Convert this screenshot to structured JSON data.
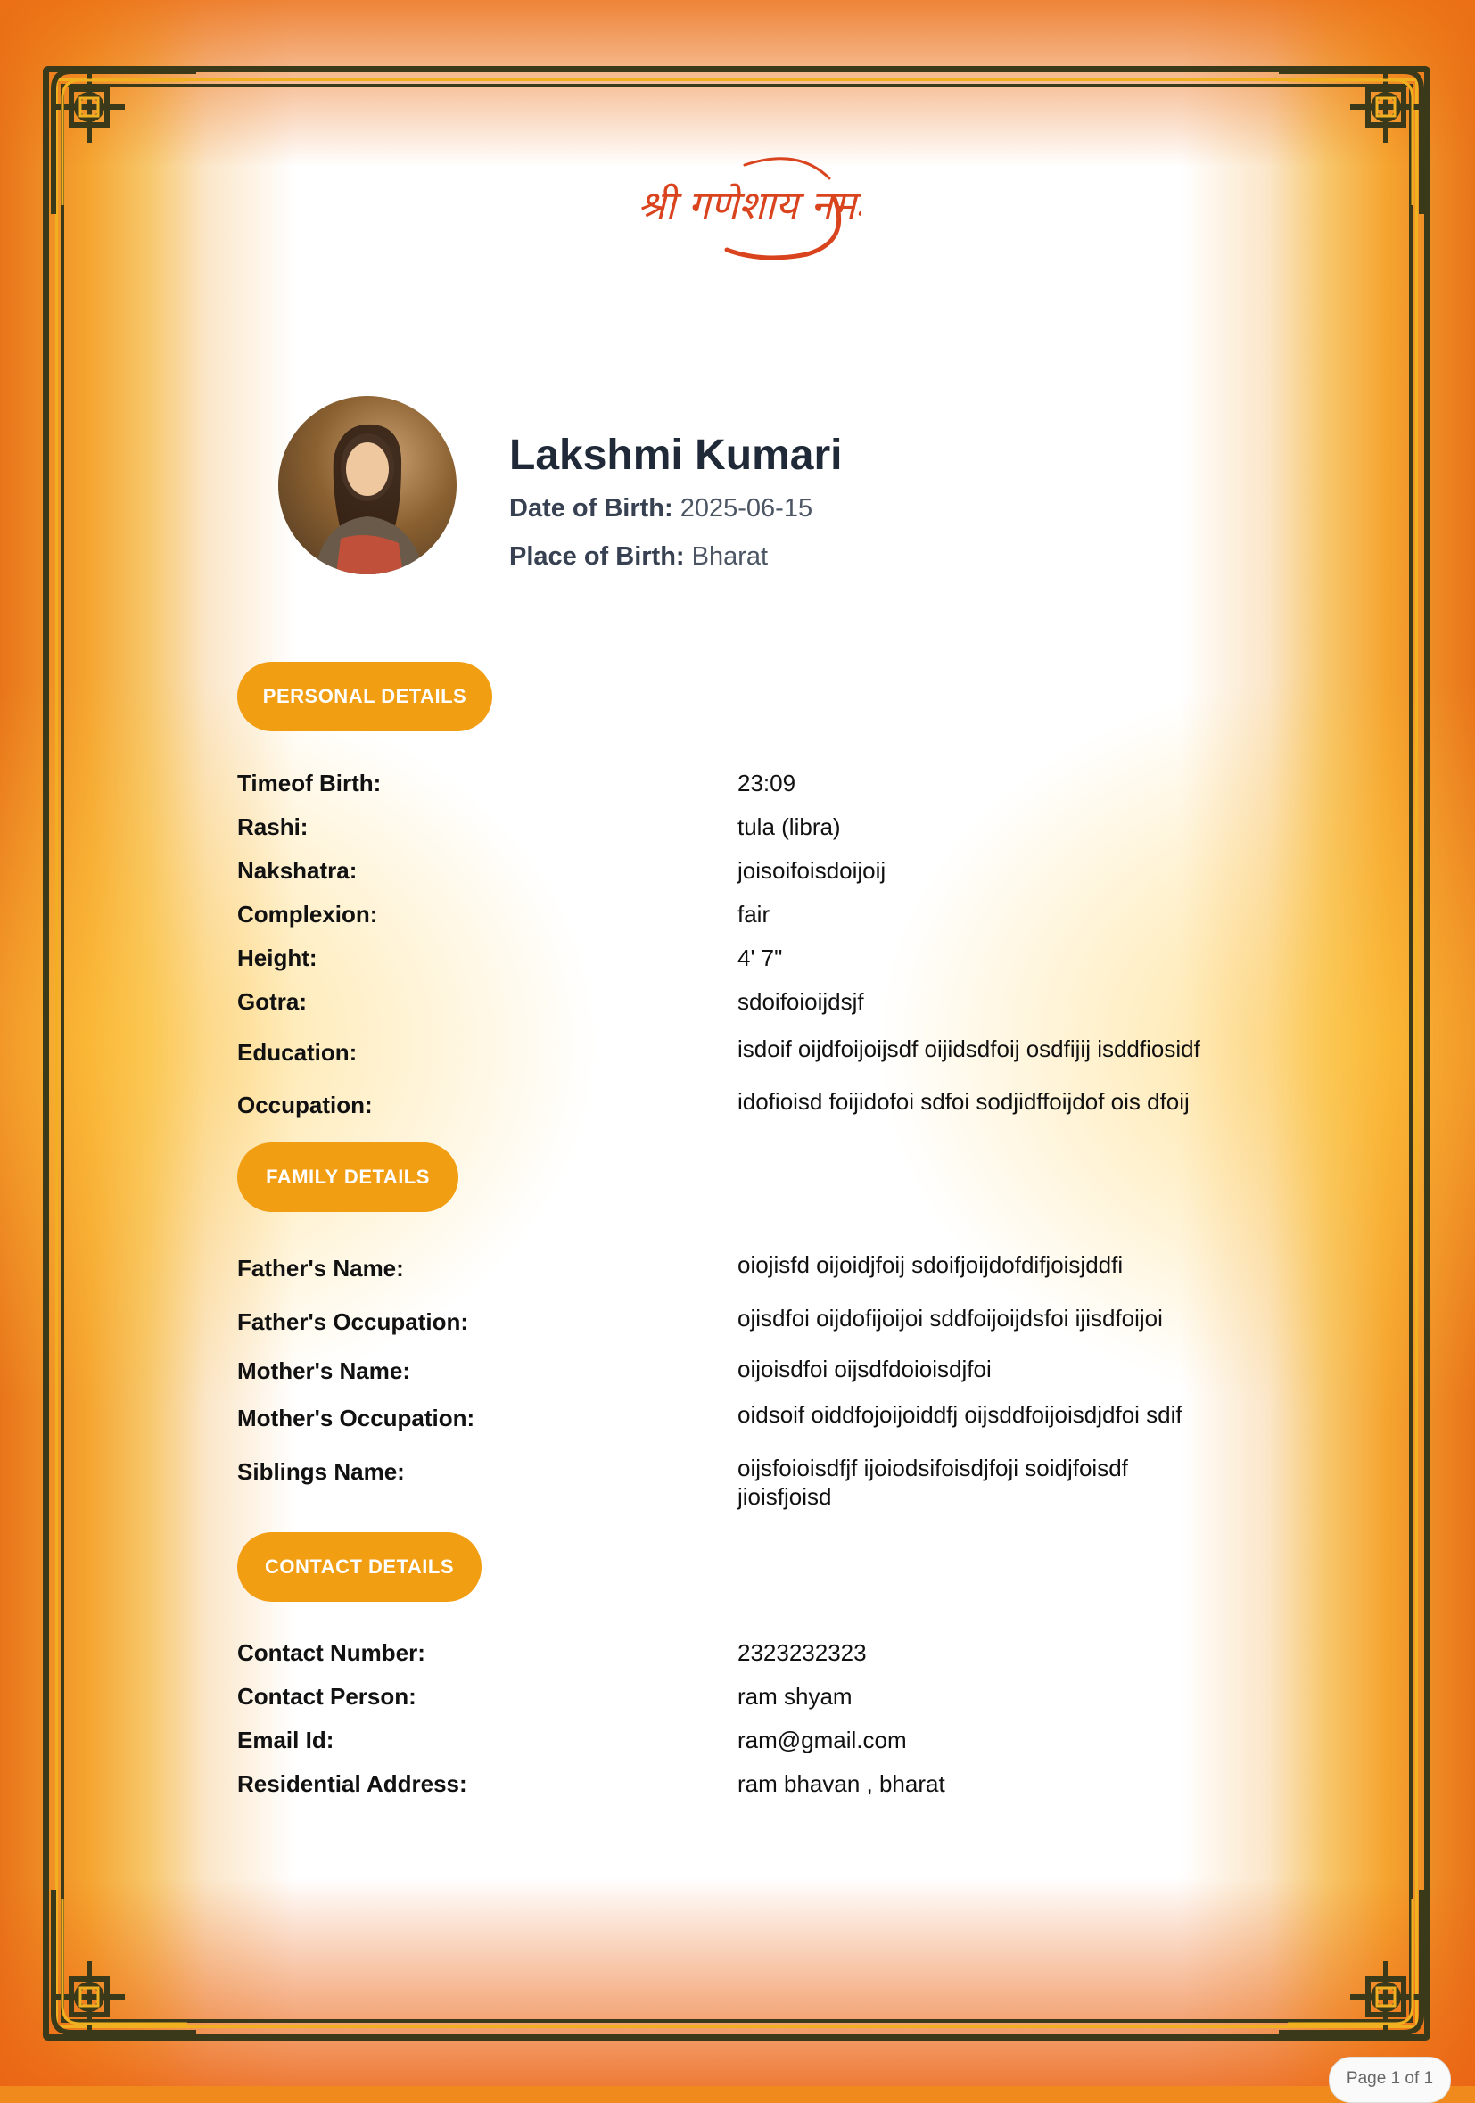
{
  "header": {
    "logo_text": "श्री गणेशाय नमः"
  },
  "profile": {
    "name": "Lakshmi Kumari",
    "dob_label": "Date of Birth:",
    "dob_value": "2025-06-15",
    "pob_label": "Place of Birth:",
    "pob_value": "Bharat"
  },
  "sections": {
    "personal": {
      "title": "PERSONAL DETAILS",
      "rows": [
        {
          "label": "Timeof Birth:",
          "value": "23:09"
        },
        {
          "label": "Rashi:",
          "value": "tula (libra)"
        },
        {
          "label": "Nakshatra:",
          "value": "joisoifoisdoijoij"
        },
        {
          "label": "Complexion:",
          "value": "fair"
        },
        {
          "label": "Height:",
          "value": "4' 7\""
        },
        {
          "label": "Gotra:",
          "value": "sdoifoioijdsjf"
        },
        {
          "label": "Education:",
          "value": "isdoif oijdfoijoijsdf oijidsdfoij osdfijij isddfiosidf"
        },
        {
          "label": "Occupation:",
          "value": "idofioisd foijidofoi sdfoi sodjidffoijdof ois dfoij"
        }
      ]
    },
    "family": {
      "title": "FAMILY DETAILS",
      "rows": [
        {
          "label": "Father's Name:",
          "value": "oiojisfd oijoidjfoij sdoifjoijdofdifjoisjddfi"
        },
        {
          "label": "Father's Occupation:",
          "value": "ojisdfoi oijdofijoijoi sddfoijoijdsfoi ijisdfoijoi"
        },
        {
          "label": "Mother's Name:",
          "value": "oijoisdfoi oijsdfdoioisdjfoi"
        },
        {
          "label": "Mother's Occupation:",
          "value": "oidsoif oiddfojoijoiddfj oijsddfoijoisdjdfoi sdif"
        },
        {
          "label": "Siblings Name:",
          "value": "oijsfoioisdfjf ijoiodsifoisdjfoji soidjfoisdf jioisfjoisd"
        }
      ]
    },
    "contact": {
      "title": "CONTACT DETAILS",
      "rows": [
        {
          "label": "Contact Number:",
          "value": "2323232323"
        },
        {
          "label": "Contact Person:",
          "value": "ram shyam"
        },
        {
          "label": "Email Id:",
          "value": "ram@gmail.com"
        },
        {
          "label": "Residential Address:",
          "value": "ram bhavan , bharat"
        }
      ]
    }
  },
  "footer": {
    "page_label": "Page 1 of 1"
  },
  "colors": {
    "accent": "#f29e12",
    "frame": "#3a3a1a",
    "logo": "#d9441e"
  }
}
